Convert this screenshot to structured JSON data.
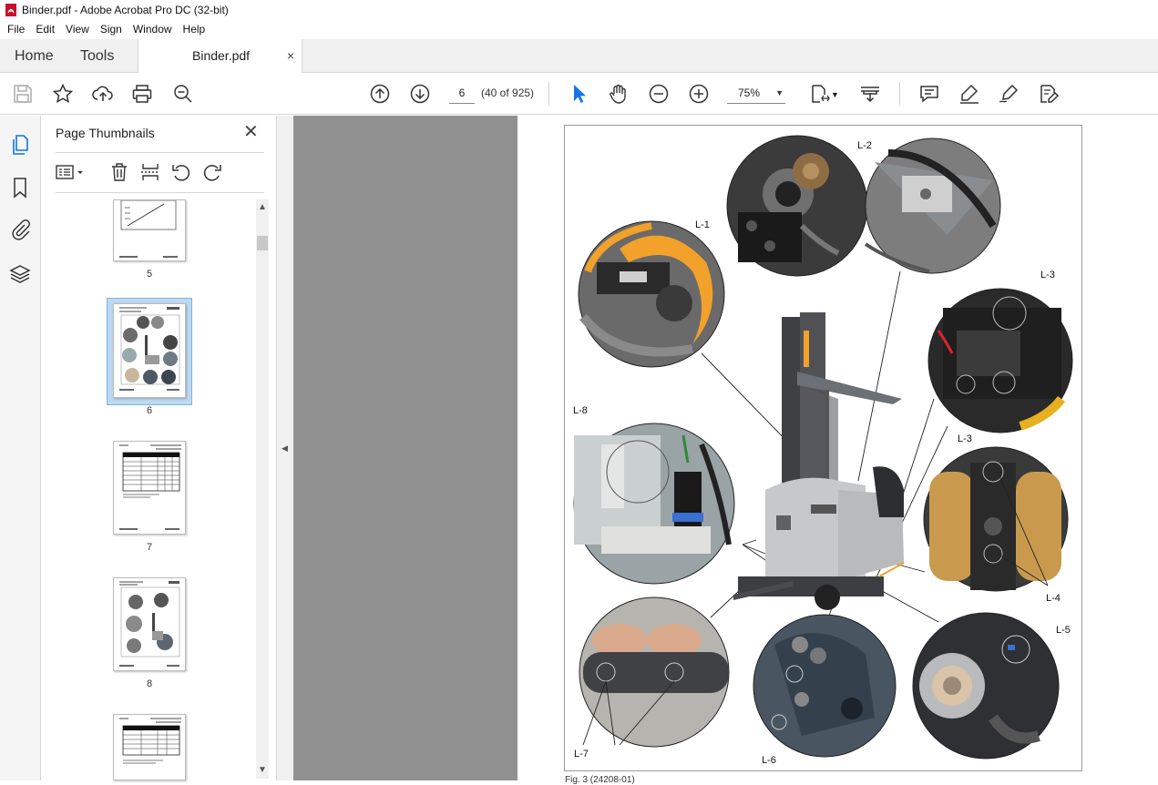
{
  "window": {
    "title": "Binder.pdf - Adobe Acrobat Pro DC (32-bit)"
  },
  "menu": [
    "File",
    "Edit",
    "View",
    "Sign",
    "Window",
    "Help"
  ],
  "tabs": {
    "home": "Home",
    "tools": "Tools",
    "document": "Binder.pdf",
    "close": "×"
  },
  "toolbar": {
    "page_current": "6",
    "page_count": "(40 of 925)",
    "zoom": "75%",
    "icons": [
      "save-icon",
      "star-icon",
      "upload-icon",
      "print-icon",
      "find-icon",
      "page-up-icon",
      "page-down-icon",
      "select-arrow-icon",
      "hand-icon",
      "zoom-out-icon",
      "zoom-in-icon",
      "page-fit-icon",
      "scroll-mode-icon",
      "comment-icon",
      "highlight-icon",
      "sign-icon",
      "edit-icon"
    ]
  },
  "left_rail_icons": [
    "pages-icon",
    "bookmark-icon",
    "attachment-icon",
    "layers-icon"
  ],
  "thumbnails_panel": {
    "title": "Page Thumbnails",
    "close": "✕",
    "tools": [
      "options-icon",
      "delete-icon",
      "page-extract-icon",
      "rotate-ccw-icon",
      "rotate-cw-icon"
    ],
    "pages": [
      "5",
      "6",
      "7",
      "8"
    ],
    "selected_page": "6"
  },
  "document": {
    "callouts": [
      "L-1",
      "L-2",
      "L-3",
      "L-3",
      "L-4",
      "L-5",
      "L-6",
      "L-7",
      "L-8"
    ],
    "caption": "Fig. 3 (24208-01)"
  },
  "colors": {
    "accent": "#1473e6",
    "panel_bg": "#f5f5f5",
    "canvas_bg": "#919191",
    "forklift_orange": "#f2a12a"
  }
}
